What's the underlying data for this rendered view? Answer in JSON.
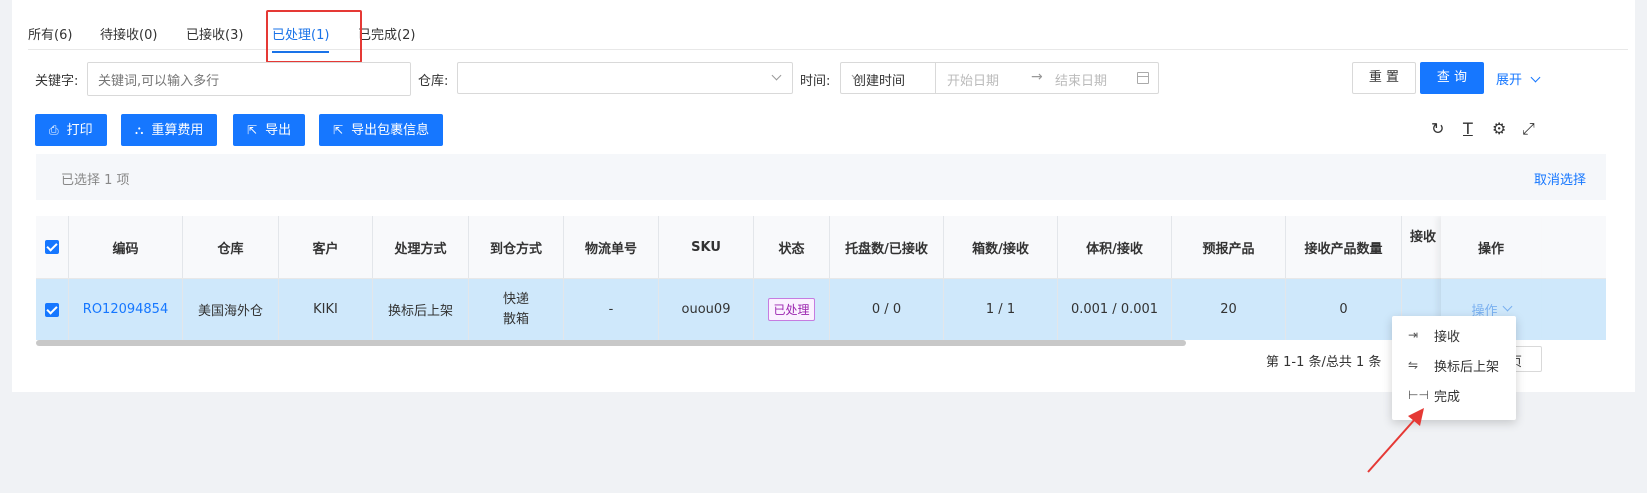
{
  "tabs": [
    {
      "label": "所有(6)"
    },
    {
      "label": "待接收(0)"
    },
    {
      "label": "已接收(3)"
    },
    {
      "label": "已处理(1)"
    },
    {
      "label": "已完成(2)"
    }
  ],
  "filters": {
    "keyword_label": "关键字:",
    "keyword_placeholder": "关键词,可以输入多行",
    "warehouse_label": "仓库:",
    "time_label": "时间:",
    "time_type": "创建时间",
    "start_placeholder": "开始日期",
    "end_placeholder": "结束日期",
    "arrow": "→",
    "reset": "重 置",
    "query": "查 询",
    "expand": "展开"
  },
  "actions": {
    "print": "打印",
    "recalc": "重算费用",
    "export": "导出",
    "export_package": "导出包裹信息"
  },
  "selection": {
    "text": "已选择  1  项",
    "cancel": "取消选择"
  },
  "table": {
    "headers": {
      "code": "编码",
      "warehouse": "仓库",
      "customer": "客户",
      "process": "处理方式",
      "arrival": "到仓方式",
      "tracking": "物流单号",
      "sku": "SKU",
      "status": "状态",
      "pallets": "托盘数/已接收",
      "boxes": "箱数/接收",
      "volume": "体积/接收",
      "forecast": "预报产品",
      "received_qty": "接收产品数量",
      "received_short": "接收",
      "op": "操作"
    },
    "row": {
      "code": "RO12094854",
      "warehouse": "美国海外仓",
      "customer": "KIKI",
      "process": "换标后上架",
      "arrival_1": "快递",
      "arrival_2": "散箱",
      "tracking": "-",
      "sku": "ouou09",
      "status": "已处理",
      "pallets": "0 / 0",
      "boxes": "1 / 1",
      "volume": "0.001 / 0.001",
      "forecast": "20",
      "received_qty": "0",
      "op": "操作"
    }
  },
  "pager": {
    "summary": "第 1-1 条/总共 1 条",
    "page_size_fragment": "页"
  },
  "menu": {
    "receive": "接收",
    "relabel": "换标后上架",
    "complete": "完成"
  },
  "colors": {
    "primary": "#1677ff",
    "highlight_row": "#cfe8fb",
    "annotation": "#e53935"
  }
}
